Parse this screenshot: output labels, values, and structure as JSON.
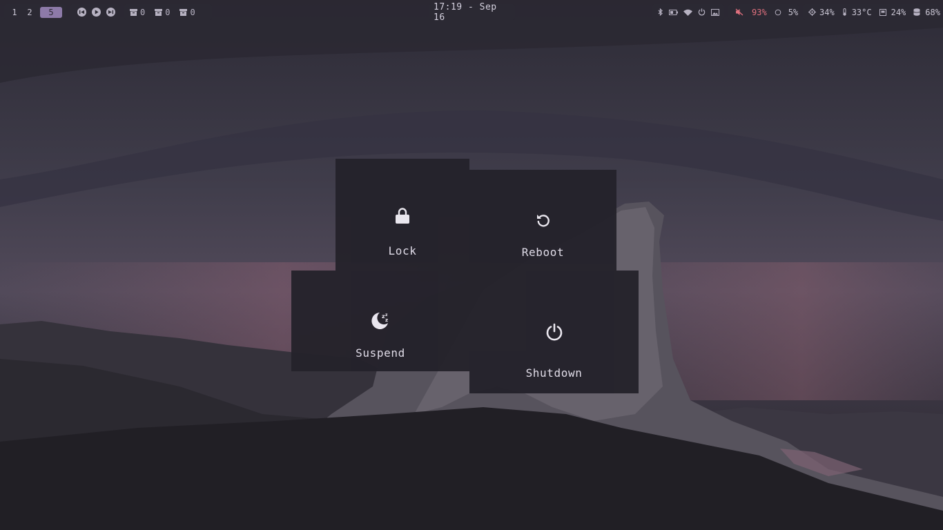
{
  "topbar": {
    "workspaces": [
      "1",
      "2",
      "5"
    ],
    "active_workspace": "5",
    "media_controls": [
      "previous-icon",
      "play-icon",
      "next-icon"
    ],
    "window_counters": [
      {
        "icon": "archive-icon",
        "count": "0"
      },
      {
        "icon": "archive-icon",
        "count": "0"
      },
      {
        "icon": "archive-icon",
        "count": "0"
      }
    ],
    "clock": "17:19 - Sep 16",
    "system_icons": [
      "bluetooth-icon",
      "battery-icon",
      "wifi-icon",
      "power-icon",
      "image-icon"
    ],
    "volume": "93%",
    "brightness": "5%",
    "cpu": "34%",
    "temperature": "33°C",
    "memory": "24%",
    "disk": "68%"
  },
  "power_menu": {
    "lock": {
      "label": "Lock",
      "icon": "lock-icon"
    },
    "reboot": {
      "label": "Reboot",
      "icon": "reboot-icon"
    },
    "suspend": {
      "label": "Suspend",
      "icon": "suspend-icon"
    },
    "shutdown": {
      "label": "Shutdown",
      "icon": "power-icon"
    }
  },
  "colors": {
    "bar_bg": "#2b2933",
    "accent": "#8d7aa8",
    "muted_volume": "#e0707e",
    "tile_bg": "#24222b"
  }
}
